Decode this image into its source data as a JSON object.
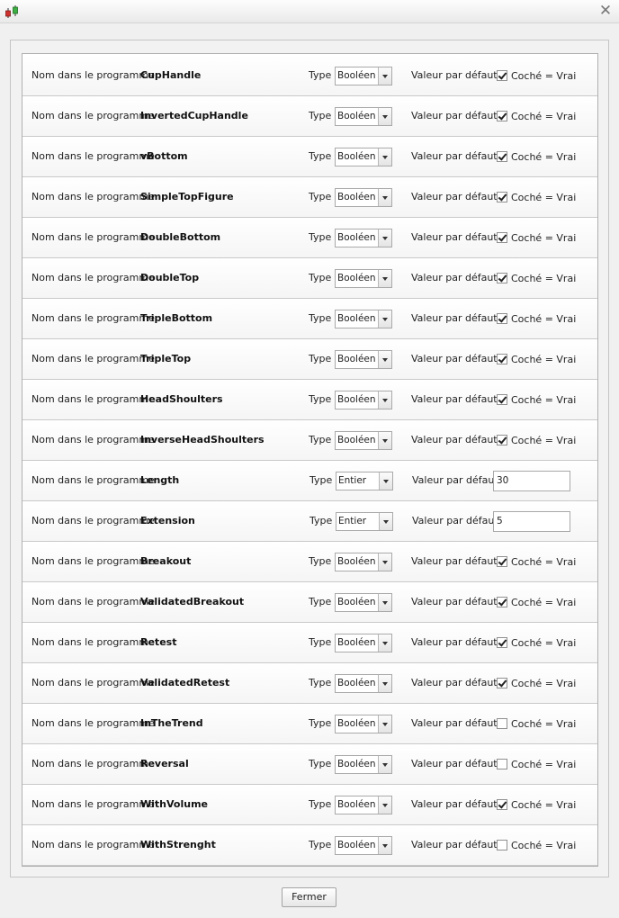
{
  "window": {
    "close_icon": "✕"
  },
  "labels": {
    "name_prefix": "Nom dans le programme",
    "type": "Type",
    "default": "Valeur par défaut",
    "checked_label": "Coché = Vrai"
  },
  "rows": [
    {
      "name": "CupHandle",
      "type": "Booléen",
      "checked": true
    },
    {
      "name": "InvertedCupHandle",
      "type": "Booléen",
      "checked": true
    },
    {
      "name": "vBottom",
      "type": "Booléen",
      "checked": true
    },
    {
      "name": "SimpleTopFigure",
      "type": "Booléen",
      "checked": true
    },
    {
      "name": "DoubleBottom",
      "type": "Booléen",
      "checked": true
    },
    {
      "name": "DoubleTop",
      "type": "Booléen",
      "checked": true
    },
    {
      "name": "TripleBottom",
      "type": "Booléen",
      "checked": true
    },
    {
      "name": "TripleTop",
      "type": "Booléen",
      "checked": true
    },
    {
      "name": "HeadShoulters",
      "type": "Booléen",
      "checked": true
    },
    {
      "name": "InverseHeadShoulters",
      "type": "Booléen",
      "checked": true
    },
    {
      "name": "Length",
      "type": "Entier",
      "value": "30"
    },
    {
      "name": "Extension",
      "type": "Entier",
      "value": "5"
    },
    {
      "name": "Breakout",
      "type": "Booléen",
      "checked": true
    },
    {
      "name": "ValidatedBreakout",
      "type": "Booléen",
      "checked": true
    },
    {
      "name": "Retest",
      "type": "Booléen",
      "checked": true
    },
    {
      "name": "ValidatedRetest",
      "type": "Booléen",
      "checked": true
    },
    {
      "name": "InTheTrend",
      "type": "Booléen",
      "checked": false
    },
    {
      "name": "Reversal",
      "type": "Booléen",
      "checked": false
    },
    {
      "name": "WithVolume",
      "type": "Booléen",
      "checked": true
    },
    {
      "name": "WithStrenght",
      "type": "Booléen",
      "checked": false
    }
  ],
  "footer": {
    "close_label": "Fermer"
  }
}
